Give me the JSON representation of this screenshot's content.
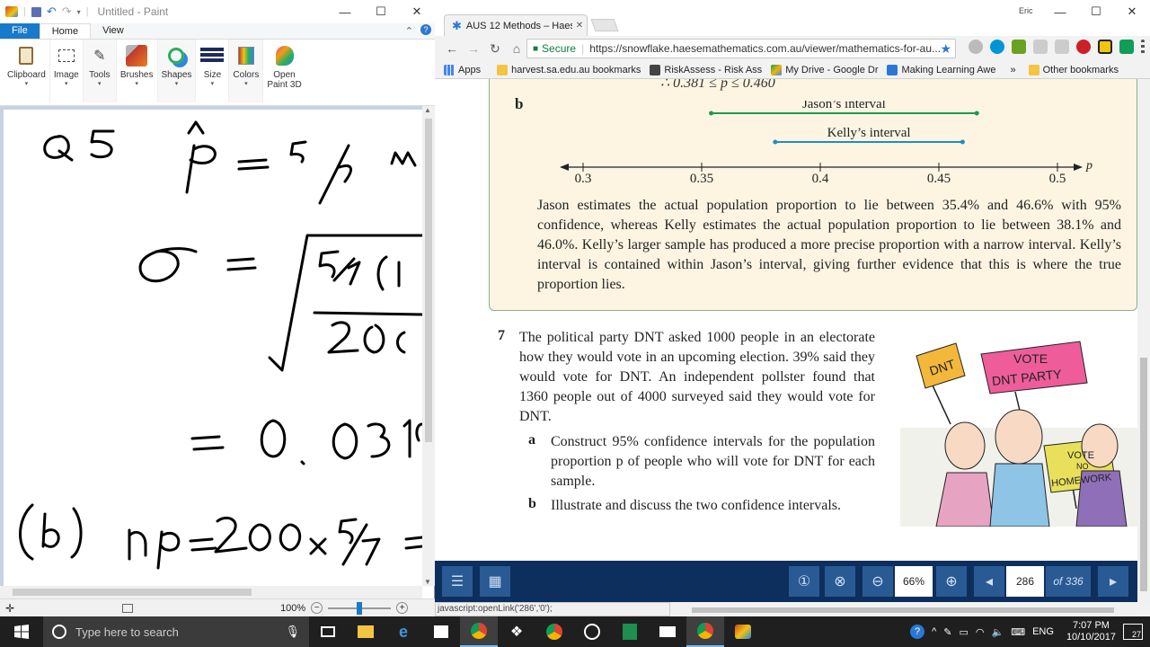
{
  "paint": {
    "title": "Untitled - Paint",
    "tabs": {
      "file": "File",
      "home": "Home",
      "view": "View"
    },
    "ribbon": {
      "clipboard": "Clipboard",
      "image": "Image",
      "tools": "Tools",
      "brushes": "Brushes",
      "shapes": "Shapes",
      "size": "Size",
      "colors": "Colors",
      "paint3d_line1": "Open",
      "paint3d_line2": "Paint 3D"
    },
    "zoom": "100%"
  },
  "chrome": {
    "tab_title": "AUS 12 Methods – Haese",
    "profile": "Eric",
    "secure_label": "Secure",
    "url": "https://snowflake.haesemathematics.com.au/viewer/mathematics-for-au...",
    "bookmarks": [
      "Apps",
      "harvest.sa.edu.au bookmarks",
      "RiskAssess - Risk Ass",
      "My Drive - Google Dr",
      "Making Learning Awe"
    ],
    "more_bookmarks": "»",
    "other_bookmarks": "Other bookmarks",
    "status_url": "javascript:openLink('286','0');"
  },
  "doc": {
    "top_fragment": "∴  0.381 ≤ p ≤ 0.460",
    "part_b": "b",
    "jason_label": "Jason’s interval",
    "kelly_label": "Kelly’s interval",
    "axis_var": "p",
    "ticks": [
      "0.3",
      "0.35",
      "0.4",
      "0.45",
      "0.5"
    ],
    "explanation": "Jason estimates the actual population proportion to lie between 35.4% and 46.6% with 95% confidence, whereas Kelly estimates the actual population proportion to lie between 38.1% and 46.0%. Kelly’s larger sample has produced a more precise proportion with a narrow interval. Kelly’s interval is contained within Jason’s interval, giving further evidence that this is where the true proportion lies.",
    "q_number": "7",
    "q_text": "The political party DNT asked 1000 people in an electorate how they would vote in an upcoming election. 39% said they would vote for DNT. An independent pollster found that 1360 people out of 4000 surveyed said they would vote for DNT.",
    "q_a_label": "a",
    "q_a_text": "Construct 95% confidence intervals for the population proportion p of people who will vote for DNT for each sample.",
    "q_b_label": "b",
    "q_b_text": "Illustrate and discuss the two confidence intervals.",
    "sign_dnt": "DNT",
    "sign_vote": "VOTE",
    "sign_party": "DNT PARTY",
    "sign_bottom_1": "VOTE",
    "sign_bottom_2": "NO",
    "sign_bottom_3": "HOMEWORK"
  },
  "chart_data": {
    "type": "line",
    "xlim": [
      0.3,
      0.5
    ],
    "xlabel": "p",
    "ticks": [
      0.3,
      0.35,
      0.4,
      0.45,
      0.5
    ],
    "series": [
      {
        "name": "Jason’s interval",
        "values": [
          0.354,
          0.466
        ],
        "color": "#1a9b4c"
      },
      {
        "name": "Kelly’s interval",
        "values": [
          0.381,
          0.46
        ],
        "color": "#1a8fc4"
      }
    ]
  },
  "viewer": {
    "zoom": "66%",
    "page": "286",
    "of_pages": "of 336"
  },
  "taskbar": {
    "search_placeholder": "Type here to search",
    "lang": "ENG",
    "time": "7:07 PM",
    "date": "10/10/2017",
    "notif_count": "27"
  }
}
